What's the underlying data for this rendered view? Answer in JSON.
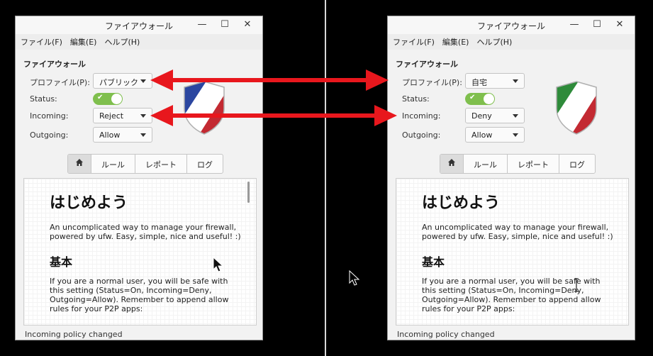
{
  "colors": {
    "arrow": "#e8171d",
    "toggle_on": "#7fbf4d"
  },
  "windows": {
    "left": {
      "title": "ファイアウォール",
      "menu": [
        "ファイル(F)",
        "編集(E)",
        "ヘルプ(H)"
      ],
      "section_title": "ファイアウォール",
      "profile_label": "プロファイル(P):",
      "profile_value": "パブリック",
      "status_label": "Status:",
      "incoming_label": "Incoming:",
      "incoming_value": "Reject",
      "outgoing_label": "Outgoing:",
      "outgoing_value": "Allow",
      "tabs": [
        "ルール",
        "レポート",
        "ログ"
      ],
      "content_h1": "はじめよう",
      "content_intro": "An uncomplicated way to manage your firewall, powered by ufw. Easy, simple, nice and useful! :)",
      "content_h2": "基本",
      "content_body": "If you are a normal user, you will be safe with this setting (Status=On, Incoming=Deny, Outgoing=Allow). Remember to append allow rules for your P2P apps:",
      "status_text": "Incoming policy changed"
    },
    "right": {
      "title": "ファイアウォール",
      "menu": [
        "ファイル(F)",
        "編集(E)",
        "ヘルプ(H)"
      ],
      "section_title": "ファイアウォール",
      "profile_label": "プロファイル(P):",
      "profile_value": "自宅",
      "status_label": "Status:",
      "incoming_label": "Incoming:",
      "incoming_value": "Deny",
      "outgoing_label": "Outgoing:",
      "outgoing_value": "Allow",
      "tabs": [
        "ルール",
        "レポート",
        "ログ"
      ],
      "content_h1": "はじめよう",
      "content_intro": "An uncomplicated way to manage your firewall, powered by ufw. Easy, simple, nice and useful! :)",
      "content_h2": "基本",
      "content_body": "If you are a normal user, you will be safe with this setting (Status=On, Incoming=Deny, Outgoing=Allow). Remember to append allow rules for your P2P apps:",
      "status_text": "Incoming policy changed"
    }
  }
}
